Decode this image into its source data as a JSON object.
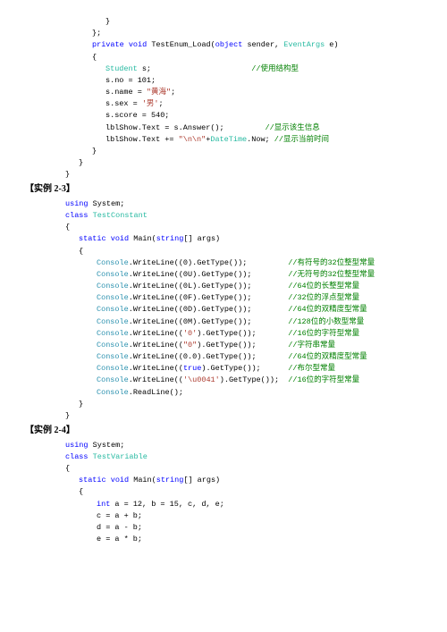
{
  "lines": [
    {
      "kind": "code",
      "indent": 90,
      "spans": [
        {
          "t": "}"
        }
      ]
    },
    {
      "kind": "code",
      "indent": 75,
      "spans": [
        {
          "t": "};"
        }
      ]
    },
    {
      "kind": "code",
      "indent": 75,
      "spans": [
        {
          "t": "private",
          "c": "kw"
        },
        {
          "t": " "
        },
        {
          "t": "void",
          "c": "kw"
        },
        {
          "t": " TestEnum_Load("
        },
        {
          "t": "object",
          "c": "kw"
        },
        {
          "t": " sender, "
        },
        {
          "t": "EventArgs",
          "c": "typeG"
        },
        {
          "t": " e)"
        }
      ]
    },
    {
      "kind": "code",
      "indent": 75,
      "spans": [
        {
          "t": "{"
        }
      ]
    },
    {
      "kind": "code",
      "indent": 90,
      "spans": [
        {
          "t": "Student",
          "c": "typeG"
        },
        {
          "t": " s;                      "
        },
        {
          "t": "//使用结构型",
          "c": "cmt"
        }
      ]
    },
    {
      "kind": "code",
      "indent": 90,
      "spans": [
        {
          "t": "s.no = 101;"
        }
      ]
    },
    {
      "kind": "code",
      "indent": 90,
      "spans": [
        {
          "t": "s.name = "
        },
        {
          "t": "\"黄海\"",
          "c": "str"
        },
        {
          "t": ";"
        }
      ]
    },
    {
      "kind": "code",
      "indent": 90,
      "spans": [
        {
          "t": "s.sex = "
        },
        {
          "t": "'男'",
          "c": "str"
        },
        {
          "t": ";"
        }
      ]
    },
    {
      "kind": "code",
      "indent": 90,
      "spans": [
        {
          "t": "s.score = 540;"
        }
      ]
    },
    {
      "kind": "code",
      "indent": 90,
      "spans": [
        {
          "t": "lblShow.Text = s.Answer();         "
        },
        {
          "t": "//显示该生信息",
          "c": "cmt"
        }
      ]
    },
    {
      "kind": "code",
      "indent": 90,
      "spans": [
        {
          "t": "lblShow.Text += "
        },
        {
          "t": "\"\\n\\n\"",
          "c": "str"
        },
        {
          "t": "+"
        },
        {
          "t": "DateTime",
          "c": "typeG"
        },
        {
          "t": ".Now; "
        },
        {
          "t": "//显示当前时间",
          "c": "cmt"
        }
      ]
    },
    {
      "kind": "code",
      "indent": 75,
      "spans": [
        {
          "t": "}"
        }
      ]
    },
    {
      "kind": "code",
      "indent": 60,
      "spans": [
        {
          "t": "}"
        }
      ]
    },
    {
      "kind": "code",
      "indent": 45,
      "spans": [
        {
          "t": "}"
        }
      ]
    },
    {
      "kind": "hdr",
      "indent": 0,
      "spans": [
        {
          "t": "【实例 2-3】"
        }
      ]
    },
    {
      "kind": "code",
      "indent": 45,
      "spans": [
        {
          "t": "using",
          "c": "kw"
        },
        {
          "t": " System;"
        }
      ]
    },
    {
      "kind": "code",
      "indent": 45,
      "spans": [
        {
          "t": "class",
          "c": "kw"
        },
        {
          "t": " "
        },
        {
          "t": "TestConstant",
          "c": "typeG"
        }
      ]
    },
    {
      "kind": "code",
      "indent": 45,
      "spans": [
        {
          "t": "{"
        }
      ]
    },
    {
      "kind": "code",
      "indent": 60,
      "spans": [
        {
          "t": "static",
          "c": "kw"
        },
        {
          "t": " "
        },
        {
          "t": "void",
          "c": "kw"
        },
        {
          "t": " Main("
        },
        {
          "t": "string",
          "c": "kw"
        },
        {
          "t": "[] args)"
        }
      ]
    },
    {
      "kind": "code",
      "indent": 60,
      "spans": [
        {
          "t": "{"
        }
      ]
    },
    {
      "kind": "code",
      "indent": 80,
      "spans": [
        {
          "t": "Console",
          "c": "type"
        },
        {
          "t": ".WriteLine((0).GetType());         "
        },
        {
          "t": "//有符号的32位整型常量",
          "c": "cmt"
        }
      ]
    },
    {
      "kind": "code",
      "indent": 80,
      "spans": [
        {
          "t": "Console",
          "c": "type"
        },
        {
          "t": ".WriteLine((0U).GetType());        "
        },
        {
          "t": "//无符号的32位整型常量",
          "c": "cmt"
        }
      ]
    },
    {
      "kind": "code",
      "indent": 80,
      "spans": [
        {
          "t": "Console",
          "c": "type"
        },
        {
          "t": ".WriteLine((0L).GetType());        "
        },
        {
          "t": "//64位的长整型常量",
          "c": "cmt"
        }
      ]
    },
    {
      "kind": "code",
      "indent": 80,
      "spans": [
        {
          "t": "Console",
          "c": "type"
        },
        {
          "t": ".WriteLine((0F).GetType());        "
        },
        {
          "t": "//32位的浮点型常量",
          "c": "cmt"
        }
      ]
    },
    {
      "kind": "code",
      "indent": 80,
      "spans": [
        {
          "t": "Console",
          "c": "type"
        },
        {
          "t": ".WriteLine((0D).GetType());        "
        },
        {
          "t": "//64位的双精度型常量",
          "c": "cmt"
        }
      ]
    },
    {
      "kind": "code",
      "indent": 80,
      "spans": [
        {
          "t": "Console",
          "c": "type"
        },
        {
          "t": ".WriteLine((0M).GetType());        "
        },
        {
          "t": "//128位的小数型常量",
          "c": "cmt"
        }
      ]
    },
    {
      "kind": "code",
      "indent": 80,
      "spans": [
        {
          "t": "Console",
          "c": "type"
        },
        {
          "t": ".WriteLine(("
        },
        {
          "t": "'0'",
          "c": "str"
        },
        {
          "t": ").GetType());       "
        },
        {
          "t": "//16位的字符型常量",
          "c": "cmt"
        }
      ]
    },
    {
      "kind": "code",
      "indent": 80,
      "spans": [
        {
          "t": "Console",
          "c": "type"
        },
        {
          "t": ".WriteLine(("
        },
        {
          "t": "\"0\"",
          "c": "str"
        },
        {
          "t": ").GetType());       "
        },
        {
          "t": "//字符串常量",
          "c": "cmt"
        }
      ]
    },
    {
      "kind": "code",
      "indent": 80,
      "spans": [
        {
          "t": "Console",
          "c": "type"
        },
        {
          "t": ".WriteLine((0.0).GetType());       "
        },
        {
          "t": "//64位的双精度型常量",
          "c": "cmt"
        }
      ]
    },
    {
      "kind": "code",
      "indent": 80,
      "spans": [
        {
          "t": "Console",
          "c": "type"
        },
        {
          "t": ".WriteLine(("
        },
        {
          "t": "true",
          "c": "kw"
        },
        {
          "t": ").GetType());      "
        },
        {
          "t": "//布尔型常量",
          "c": "cmt"
        }
      ]
    },
    {
      "kind": "code",
      "indent": 80,
      "spans": [
        {
          "t": "Console",
          "c": "type"
        },
        {
          "t": ".WriteLine(("
        },
        {
          "t": "'\\u0041'",
          "c": "str"
        },
        {
          "t": ").GetType());  "
        },
        {
          "t": "//16位的字符型常量",
          "c": "cmt"
        }
      ]
    },
    {
      "kind": "code",
      "indent": 80,
      "spans": [
        {
          "t": "Console",
          "c": "type"
        },
        {
          "t": ".ReadLine();"
        }
      ]
    },
    {
      "kind": "code",
      "indent": 60,
      "spans": [
        {
          "t": "}"
        }
      ]
    },
    {
      "kind": "code",
      "indent": 45,
      "spans": [
        {
          "t": "}"
        }
      ]
    },
    {
      "kind": "hdr",
      "indent": 0,
      "spans": [
        {
          "t": "【实例 2-4】"
        }
      ]
    },
    {
      "kind": "code",
      "indent": 45,
      "spans": [
        {
          "t": "using",
          "c": "kw"
        },
        {
          "t": " System;"
        }
      ]
    },
    {
      "kind": "code",
      "indent": 45,
      "spans": [
        {
          "t": "class",
          "c": "kw"
        },
        {
          "t": " "
        },
        {
          "t": "TestVariable",
          "c": "typeG"
        }
      ]
    },
    {
      "kind": "code",
      "indent": 45,
      "spans": [
        {
          "t": "{"
        }
      ]
    },
    {
      "kind": "code",
      "indent": 60,
      "spans": [
        {
          "t": "static",
          "c": "kw"
        },
        {
          "t": " "
        },
        {
          "t": "void",
          "c": "kw"
        },
        {
          "t": " Main("
        },
        {
          "t": "string",
          "c": "kw"
        },
        {
          "t": "[] args)"
        }
      ]
    },
    {
      "kind": "code",
      "indent": 60,
      "spans": [
        {
          "t": "{"
        }
      ]
    },
    {
      "kind": "code",
      "indent": 80,
      "spans": [
        {
          "t": "int",
          "c": "kw"
        },
        {
          "t": " a = 12, b = 15, c, d, e;"
        }
      ]
    },
    {
      "kind": "code",
      "indent": 80,
      "spans": [
        {
          "t": "c = a + b;"
        }
      ]
    },
    {
      "kind": "code",
      "indent": 80,
      "spans": [
        {
          "t": "d = a - b;"
        }
      ]
    },
    {
      "kind": "code",
      "indent": 80,
      "spans": [
        {
          "t": "e = a * b;"
        }
      ]
    }
  ]
}
